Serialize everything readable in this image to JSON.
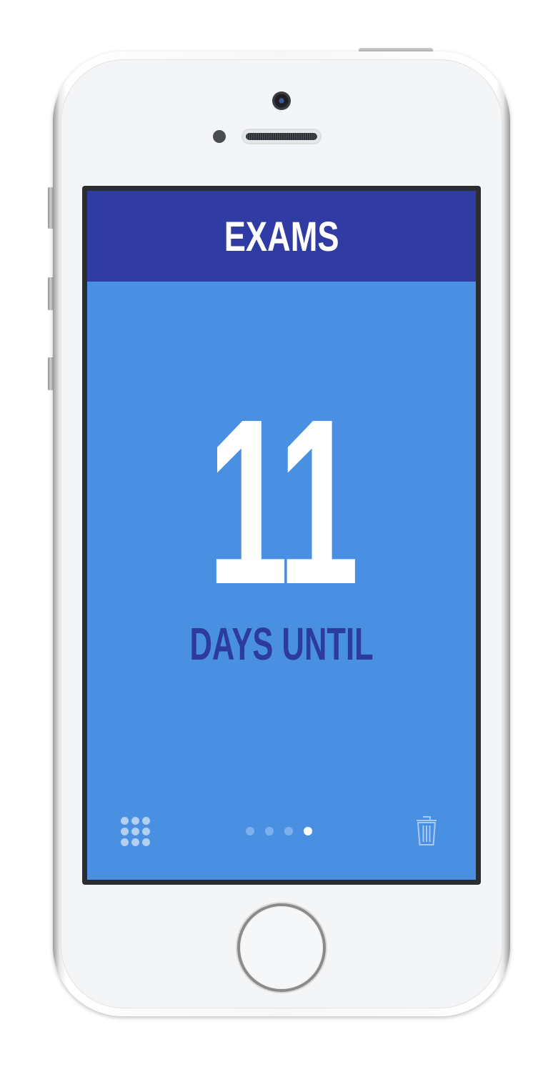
{
  "app": {
    "title": "EXAMS",
    "days_remaining": "11",
    "caption": "DAYS UNTIL"
  },
  "pager": {
    "page_count": 4,
    "active_index": 3
  },
  "toolbar": {
    "left_icon": "grid-icon",
    "right_icon": "trash-icon"
  },
  "colors": {
    "header_bg": "#303ba3",
    "screen_bg": "#4a90e2",
    "number_text": "#ffffff",
    "caption_text": "#2d3a9e",
    "dot_inactive": "#7db0ec",
    "dot_active": "#ffffff"
  }
}
